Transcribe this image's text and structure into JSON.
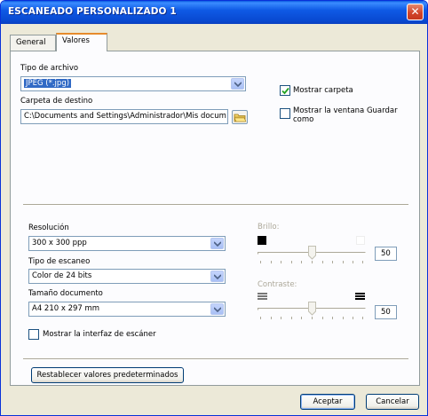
{
  "window": {
    "title": "ESCANEADO PERSONALIZADO 1",
    "close_glyph": "✕"
  },
  "tabs": [
    {
      "label": "General",
      "active": false
    },
    {
      "label": "Valores",
      "active": true
    }
  ],
  "file_type": {
    "label": "Tipo de archivo",
    "value": "JPEG (*.jpg)"
  },
  "destination": {
    "label": "Carpeta de destino",
    "value": "C:\\Documents and Settings\\Administrador\\Mis docum",
    "browse_icon": "folder-browse-icon"
  },
  "options": {
    "show_folder": {
      "label": "Mostrar carpeta",
      "checked": true
    },
    "show_save_as": {
      "label_line1": "Mostrar la ventana Guardar",
      "label_line2": "como",
      "checked": false
    }
  },
  "resolution": {
    "label": "Resolución",
    "value": "300 x 300 ppp"
  },
  "scan_type": {
    "label": "Tipo de escaneo",
    "value": "Color de 24 bits"
  },
  "doc_size": {
    "label": "Tamaño documento",
    "value": "A4 210 x 297 mm"
  },
  "show_scanner_interface": {
    "label": "Mostrar la interfaz de escáner",
    "checked": false
  },
  "brightness": {
    "label": "Brillo:",
    "value": "50",
    "level": 0.5,
    "enabled": false
  },
  "contrast": {
    "label": "Contraste:",
    "value": "50",
    "level": 0.5,
    "enabled": false
  },
  "buttons": {
    "restore_defaults": "Restablecer valores predeterminados",
    "accept": "Aceptar",
    "cancel": "Cancelar"
  },
  "colors": {
    "title_bar": "#0a58e0",
    "selection": "#316ac5",
    "tab_highlight": "#e68b2c",
    "disabled_text": "#aca899"
  }
}
